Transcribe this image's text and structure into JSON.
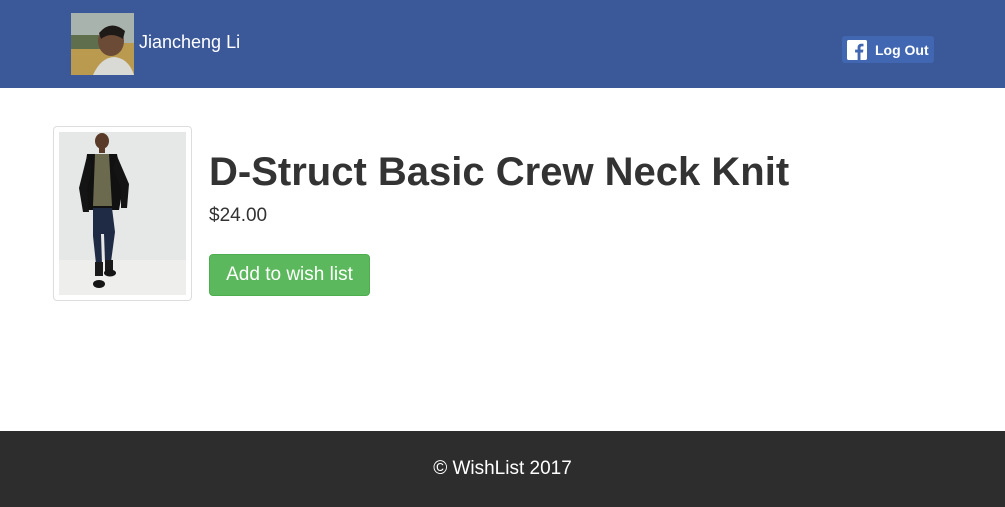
{
  "header": {
    "user_name": "Jiancheng Li",
    "logout_label": "Log Out",
    "avatar_icon": "user-avatar-icon",
    "facebook_icon": "facebook-icon",
    "colors": {
      "bar": "#3b5998",
      "button": "#4267b2"
    }
  },
  "product": {
    "title": "D-Struct Basic Crew Neck Knit",
    "price": "$24.00",
    "image_icon": "product-photo-icon",
    "add_button_label": "Add to wish list",
    "colors": {
      "button": "#5cb85c"
    }
  },
  "footer": {
    "text": "© WishList 2017",
    "colors": {
      "background": "#2d2d2d"
    }
  }
}
